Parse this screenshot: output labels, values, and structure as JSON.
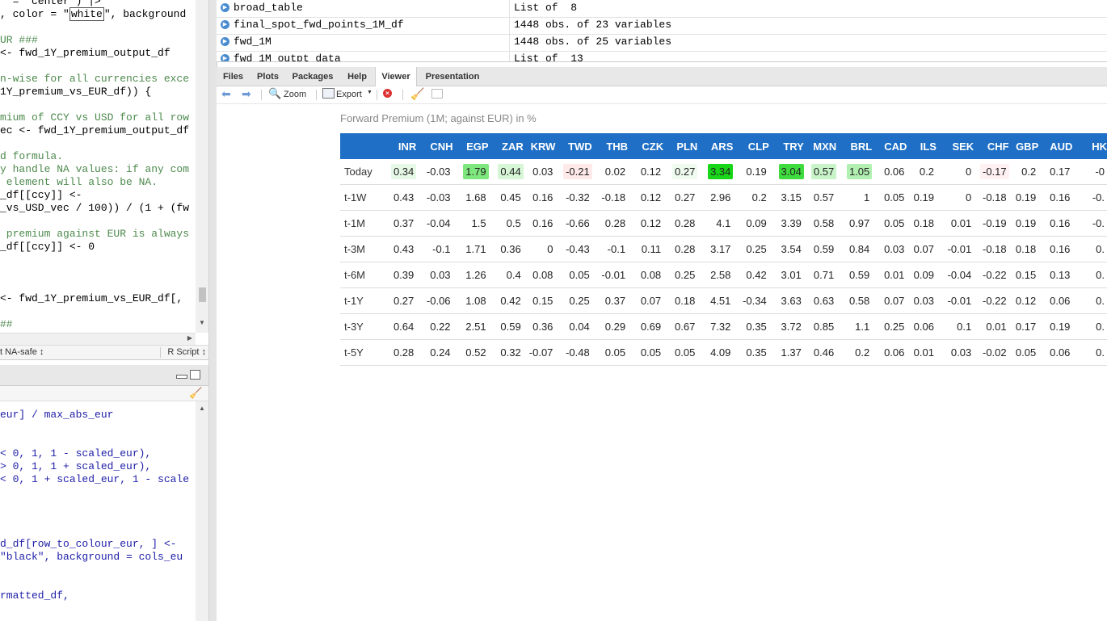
{
  "editor": {
    "lines": [
      {
        "text": "  =  center ) |>",
        "type": "code"
      },
      {
        "parts": [
          ", color = \"",
          "white",
          "\", background"
        ],
        "type": "boxed"
      },
      {
        "text": "UR ###",
        "type": "comment"
      },
      {
        "text": "<- fwd_1Y_premium_output_df",
        "type": "code"
      },
      {
        "text": "n-wise for all currencies exce",
        "type": "comment"
      },
      {
        "text": "1Y_premium_vs_EUR_df)) {",
        "type": "code"
      },
      {
        "text": "mium of CCY vs USD for all row",
        "type": "comment"
      },
      {
        "text": "ec <- fwd_1Y_premium_output_df",
        "type": "code"
      },
      {
        "text": "d formula.",
        "type": "comment"
      },
      {
        "text": "y handle NA values: if any com",
        "type": "comment"
      },
      {
        "text": " element will also be NA.",
        "type": "comment"
      },
      {
        "text": "_df[[ccy]] <-",
        "type": "code"
      },
      {
        "text": "_vs_USD_vec / 100)) / (1 + (fw",
        "type": "code"
      },
      {
        "text": " premium against EUR is always",
        "type": "comment"
      },
      {
        "text": "_df[[ccy]] <- 0",
        "type": "code"
      },
      {
        "text": "<- fwd_1Y_premium_vs_EUR_df[,",
        "type": "code"
      },
      {
        "text": "##",
        "type": "comment"
      }
    ],
    "status_left": "t NA-safe ↕",
    "status_right": "R Script ↕"
  },
  "console": {
    "lines": [
      "eur] / max_abs_eur",
      "< 0, 1, 1 - scaled_eur),",
      "> 0, 1, 1 + scaled_eur),",
      "< 0, 1 + scaled_eur, 1 - scale",
      "d_df[row_to_colour_eur, ] <-",
      "\"black\", background = cols_eu",
      "rmatted_df,"
    ]
  },
  "environment": {
    "rows": [
      {
        "name": "broad_table",
        "value": "List of  8"
      },
      {
        "name": "final_spot_fwd_points_1M_df",
        "value": "1448 obs. of 23 variables"
      },
      {
        "name": "fwd_1M",
        "value": "1448 obs. of 25 variables"
      },
      {
        "name": "fwd_1M_outpt_data",
        "value": "List of  13"
      }
    ]
  },
  "tabs": [
    "Files",
    "Plots",
    "Packages",
    "Help",
    "Viewer",
    "Presentation"
  ],
  "active_tab": "Viewer",
  "toolbar": {
    "zoom": "Zoom",
    "export": "Export"
  },
  "viewer": {
    "caption": "Forward Premium (1M; against EUR) in %",
    "columns": [
      "INR",
      "CNH",
      "EGP",
      "ZAR",
      "KRW",
      "TWD",
      "THB",
      "CZK",
      "PLN",
      "ARS",
      "CLP",
      "TRY",
      "MXN",
      "BRL",
      "CAD",
      "ILS",
      "SEK",
      "CHF",
      "GBP",
      "AUD",
      "HK"
    ],
    "rows": [
      {
        "label": "Today",
        "values": [
          "0.34",
          "-0.03",
          "1.79",
          "0.44",
          "0.03",
          "-0.21",
          "0.02",
          "0.12",
          "0.27",
          "3.34",
          "0.19",
          "3.04",
          "0.57",
          "1.05",
          "0.06",
          "0.2",
          "0",
          "-0.17",
          "0.2",
          "0.17",
          "-0"
        ]
      },
      {
        "label": "t-1W",
        "values": [
          "0.43",
          "-0.03",
          "1.68",
          "0.45",
          "0.16",
          "-0.32",
          "-0.18",
          "0.12",
          "0.27",
          "2.96",
          "0.2",
          "3.15",
          "0.57",
          "1",
          "0.05",
          "0.19",
          "0",
          "-0.18",
          "0.19",
          "0.16",
          "-0."
        ]
      },
      {
        "label": "t-1M",
        "values": [
          "0.37",
          "-0.04",
          "1.5",
          "0.5",
          "0.16",
          "-0.66",
          "0.28",
          "0.12",
          "0.28",
          "4.1",
          "0.09",
          "3.39",
          "0.58",
          "0.97",
          "0.05",
          "0.18",
          "0.01",
          "-0.19",
          "0.19",
          "0.16",
          "-0."
        ]
      },
      {
        "label": "t-3M",
        "values": [
          "0.43",
          "-0.1",
          "1.71",
          "0.36",
          "0",
          "-0.43",
          "-0.1",
          "0.11",
          "0.28",
          "3.17",
          "0.25",
          "3.54",
          "0.59",
          "0.84",
          "0.03",
          "0.07",
          "-0.01",
          "-0.18",
          "0.18",
          "0.16",
          "0."
        ]
      },
      {
        "label": "t-6M",
        "values": [
          "0.39",
          "0.03",
          "1.26",
          "0.4",
          "0.08",
          "0.05",
          "-0.01",
          "0.08",
          "0.25",
          "2.58",
          "0.42",
          "3.01",
          "0.71",
          "0.59",
          "0.01",
          "0.09",
          "-0.04",
          "-0.22",
          "0.15",
          "0.13",
          "0."
        ]
      },
      {
        "label": "t-1Y",
        "values": [
          "0.27",
          "-0.06",
          "1.08",
          "0.42",
          "0.15",
          "0.25",
          "0.37",
          "0.07",
          "0.18",
          "4.51",
          "-0.34",
          "3.63",
          "0.63",
          "0.58",
          "0.07",
          "0.03",
          "-0.01",
          "-0.22",
          "0.12",
          "0.06",
          "0."
        ]
      },
      {
        "label": "t-3Y",
        "values": [
          "0.64",
          "0.22",
          "2.51",
          "0.59",
          "0.36",
          "0.04",
          "0.29",
          "0.69",
          "0.67",
          "7.32",
          "0.35",
          "3.72",
          "0.85",
          "1.1",
          "0.25",
          "0.06",
          "0.1",
          "0.01",
          "0.17",
          "0.19",
          "0."
        ]
      },
      {
        "label": "t-5Y",
        "values": [
          "0.28",
          "0.24",
          "0.52",
          "0.32",
          "-0.07",
          "-0.48",
          "0.05",
          "0.05",
          "0.05",
          "4.09",
          "0.35",
          "1.37",
          "0.46",
          "0.2",
          "0.06",
          "0.01",
          "0.03",
          "-0.02",
          "0.05",
          "0.06",
          "0."
        ]
      }
    ],
    "today_backgrounds": [
      "#e6f9e6",
      "#ffffff",
      "#7ee87e",
      "#d6f6d6",
      "#ffffff",
      "#ffe9e9",
      "#ffffff",
      "#ffffff",
      "#f0fbf0",
      "#19d619",
      "#ffffff",
      "#3fdc3f",
      "#c9f3c9",
      "#b2f0b2",
      "#ffffff",
      "#ffffff",
      "#ffffff",
      "#fff1f1",
      "#ffffff",
      "#ffffff",
      "#ffffff"
    ],
    "colors": {
      "header_bg": "#1e6fc5",
      "header_text": "#ffffff"
    }
  }
}
